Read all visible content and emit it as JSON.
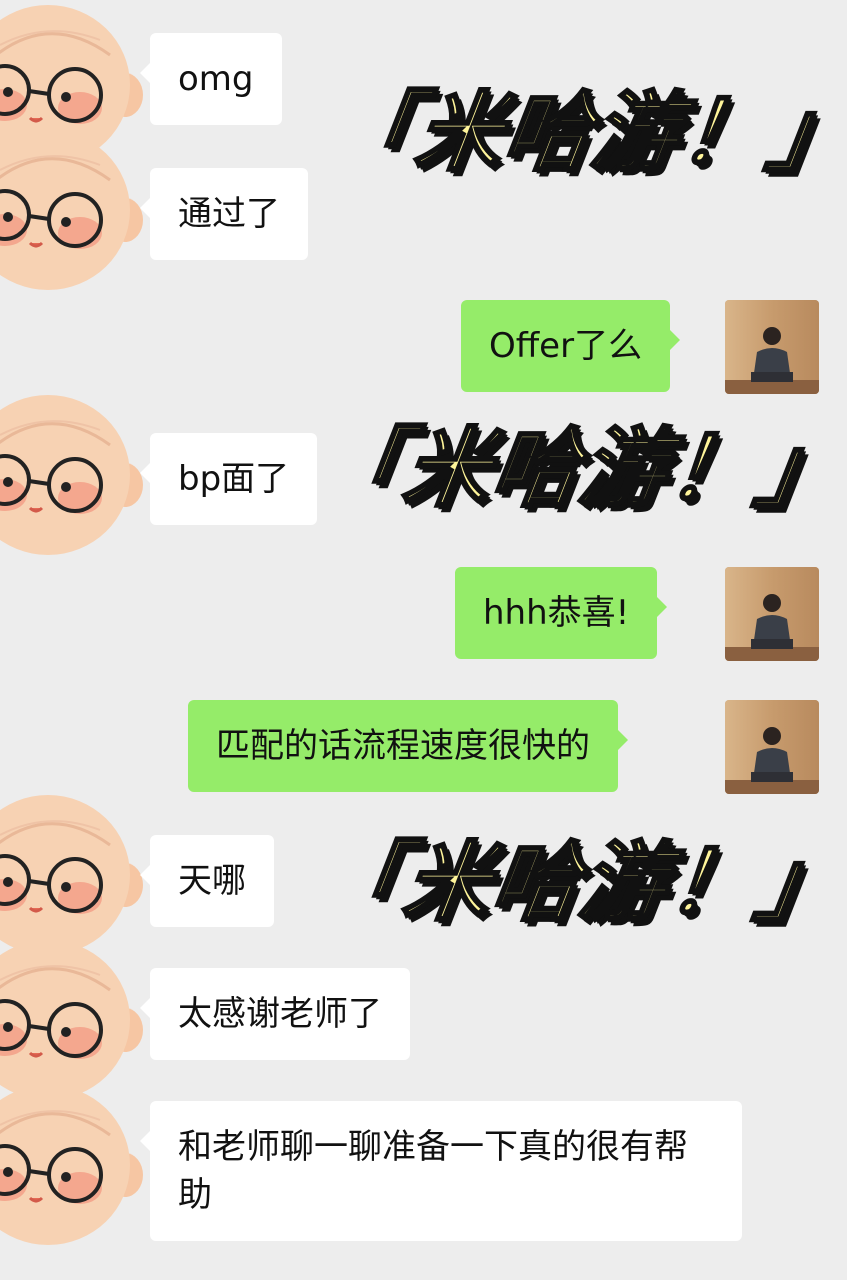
{
  "messages": [
    {
      "side": "left",
      "text": "omg"
    },
    {
      "side": "left",
      "text": "通过了"
    },
    {
      "side": "right",
      "text": "Offer了么"
    },
    {
      "side": "left",
      "text": "bp面了"
    },
    {
      "side": "right",
      "text": "hhh恭喜!"
    },
    {
      "side": "right",
      "text": "匹配的话流程速度很快的"
    },
    {
      "side": "left",
      "text": "天哪"
    },
    {
      "side": "left",
      "text": "太感谢老师了"
    },
    {
      "side": "left",
      "text": "和老师聊一聊准备一下真的很有帮助"
    }
  ],
  "overlay": {
    "sticker_text": "「米哈游！」"
  },
  "colors": {
    "background": "#ededed",
    "incoming_bubble": "#ffffff",
    "outgoing_bubble": "#95ec69",
    "sticker_fill": "#fff59a"
  },
  "icons": {
    "left_avatar": "cartoon-bald-glasses-avatar-icon",
    "right_avatar": "photo-person-sitting-avatar-icon"
  }
}
